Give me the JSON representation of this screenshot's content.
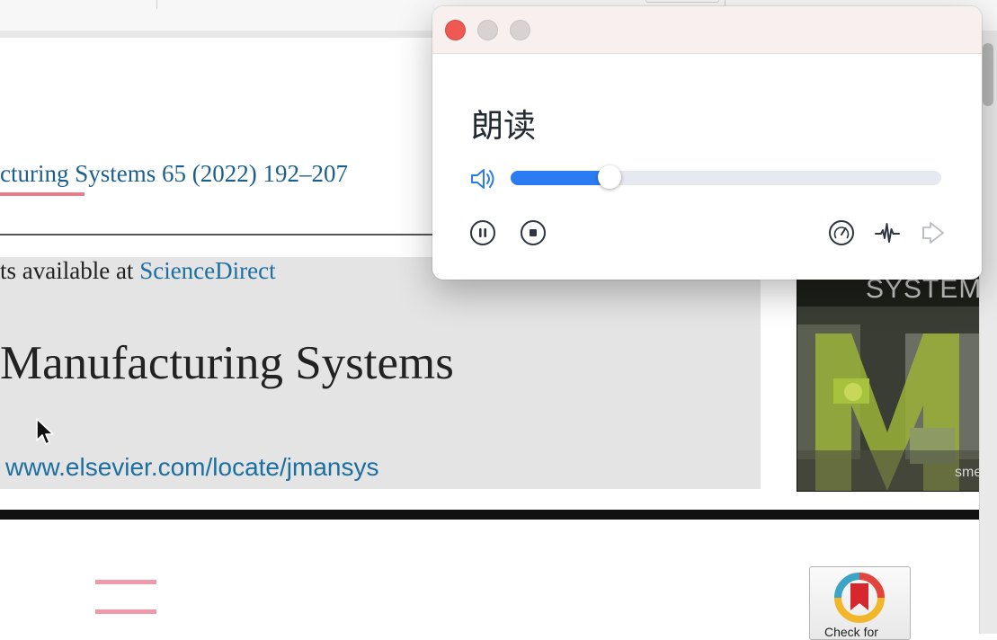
{
  "document": {
    "citation": "cturing Systems 65 (2022) 192–207",
    "contents_prefix": "ts available at ",
    "contents_link": "ScienceDirect",
    "journal_title": "Manufacturing Systems",
    "journal_url": "www.elsevier.com/locate/jmansys",
    "cover_text": "SYSTEMS",
    "cover_brand": "sme",
    "check_badge_label": "Check for"
  },
  "popup": {
    "title": "朗读",
    "progress": 0.23,
    "window_buttons": [
      "close",
      "minimize",
      "maximize"
    ],
    "controls_left": [
      "pause-icon",
      "stop-icon"
    ],
    "controls_right": [
      "speed-gauge-icon",
      "waveform-icon",
      "exit-icon"
    ],
    "accent_color": "#2b7cf2"
  }
}
